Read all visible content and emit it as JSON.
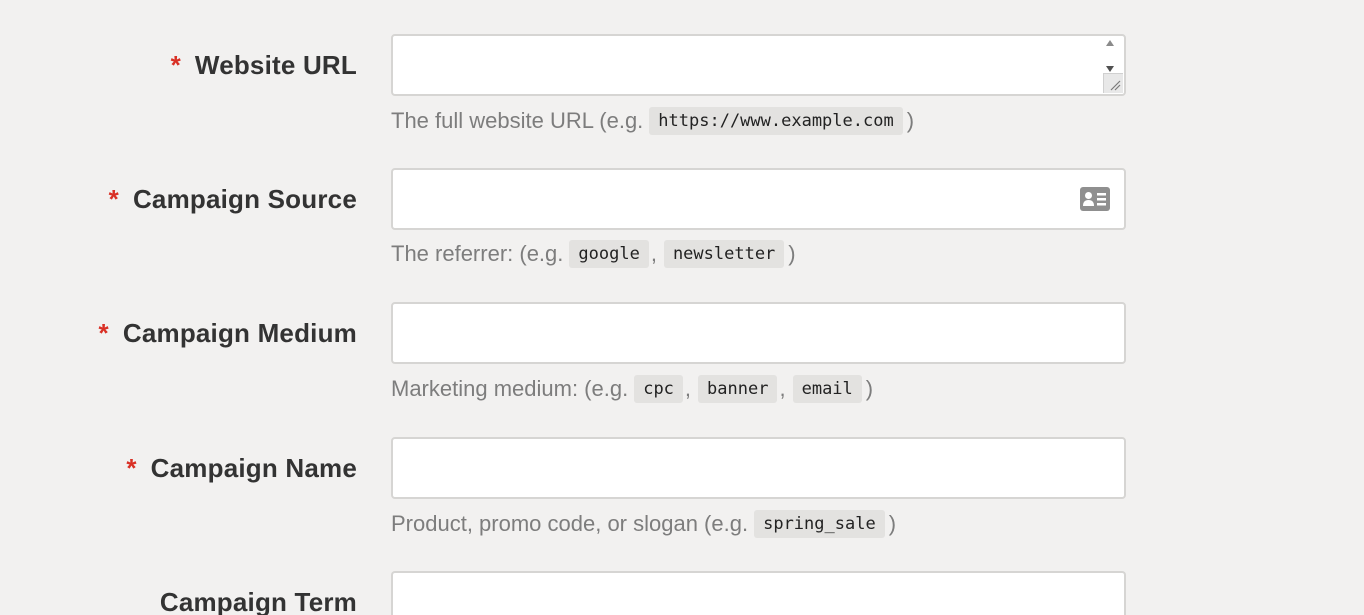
{
  "fields": [
    {
      "label": "Website URL",
      "required_mark": "*",
      "value": "",
      "hint_prefix": "The full website URL (e.g.",
      "hint_codes": [
        "https://www.example.com"
      ],
      "hint_suffix": ")"
    },
    {
      "label": "Campaign Source",
      "required_mark": "*",
      "value": "",
      "hint_prefix": "The referrer: (e.g.",
      "hint_codes": [
        "google",
        "newsletter"
      ],
      "hint_suffix": ")"
    },
    {
      "label": "Campaign Medium",
      "required_mark": "*",
      "value": "",
      "hint_prefix": "Marketing medium: (e.g.",
      "hint_codes": [
        "cpc",
        "banner",
        "email"
      ],
      "hint_suffix": ")"
    },
    {
      "label": "Campaign Name",
      "required_mark": "*",
      "value": "",
      "hint_prefix": "Product, promo code, or slogan (e.g.",
      "hint_codes": [
        "spring_sale"
      ],
      "hint_suffix": ")"
    },
    {
      "label": "Campaign Term",
      "value": ""
    }
  ],
  "separator": ",",
  "icons": {
    "spinner": "spinner-arrows-icon",
    "resize": "resize-grip-icon",
    "contact_card": "contact-card-icon"
  },
  "colors": {
    "background": "#f2f1f0",
    "required": "#d93025",
    "label": "#333333",
    "hint": "#7d7d7d",
    "code_bg": "#e3e2e0",
    "field_border": "#d6d5d3"
  }
}
